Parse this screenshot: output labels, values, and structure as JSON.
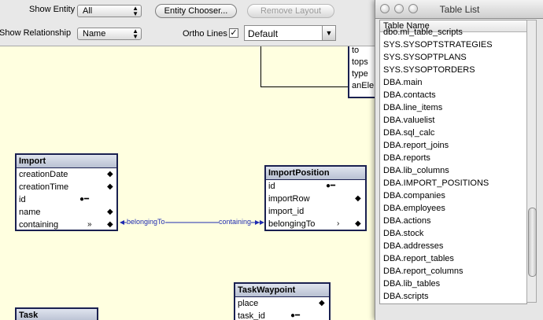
{
  "toolbar": {
    "show_entity_label": "Show Entity",
    "show_entity_value": "All",
    "entity_chooser_label": "Entity Chooser...",
    "remove_layout_label": "Remove Layout",
    "show_relationship_label": "Show Relationship",
    "show_relationship_value": "Name",
    "ortho_lines_label": "Ortho Lines",
    "ortho_lines_checked": "✓",
    "layout_value": "Default"
  },
  "partial_entity": {
    "attrs": [
      "to",
      "tops",
      "type",
      "anEle"
    ]
  },
  "entities": {
    "import": {
      "title": "Import",
      "attrs": [
        "creationDate",
        "creationTime",
        "id",
        "name",
        "containing"
      ]
    },
    "import_position": {
      "title": "ImportPosition",
      "attrs": [
        "id",
        "importRow",
        "import_id",
        "belongingTo"
      ]
    },
    "task_waypoint": {
      "title": "TaskWaypoint",
      "attrs": [
        "place",
        "task_id"
      ]
    },
    "task": {
      "title": "Task"
    }
  },
  "relationship": {
    "left_label": "belongingTo",
    "right_label": "containing"
  },
  "table_list": {
    "title": "Table List",
    "column_header": "Table Name",
    "items": [
      "dbo.ml_table_scripts",
      "SYS.SYSOPTSTRATEGIES",
      "SYS.SYSOPTPLANS",
      "SYS.SYSOPTORDERS",
      "DBA.main",
      "DBA.contacts",
      "DBA.line_items",
      "DBA.valuelist",
      "DBA.sql_calc",
      "DBA.report_joins",
      "DBA.reports",
      "DBA.lib_columns",
      "DBA.IMPORT_POSITIONS",
      "DBA.companies",
      "DBA.employees",
      "DBA.actions",
      "DBA.stock",
      "DBA.addresses",
      "DBA.report_tables",
      "DBA.report_columns",
      "DBA.lib_tables",
      "DBA.scripts"
    ]
  }
}
